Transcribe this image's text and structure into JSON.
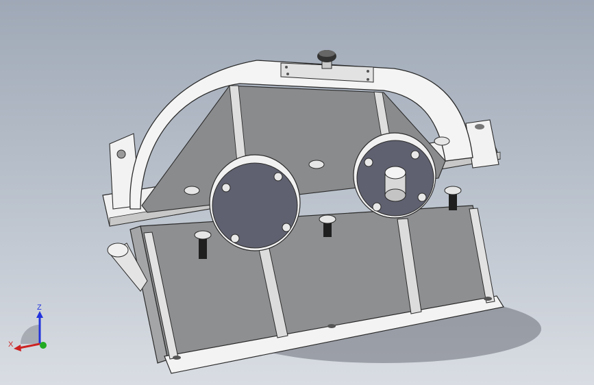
{
  "viewport": {
    "background_top": "#9fa8b6",
    "background_bottom": "#d9dde3"
  },
  "model": {
    "description_icon": "gear-reducer-housing",
    "body_color": "#8c8d8f",
    "cover_color": "#f2f2f2",
    "bearing_cap_color": "#5f6170",
    "edge_color": "#2a2a2a"
  },
  "triad": {
    "z_label": "Z",
    "x_label": "X",
    "z_color": "#2233dd",
    "x_color": "#cc2222",
    "y_color": "#22aa22"
  }
}
